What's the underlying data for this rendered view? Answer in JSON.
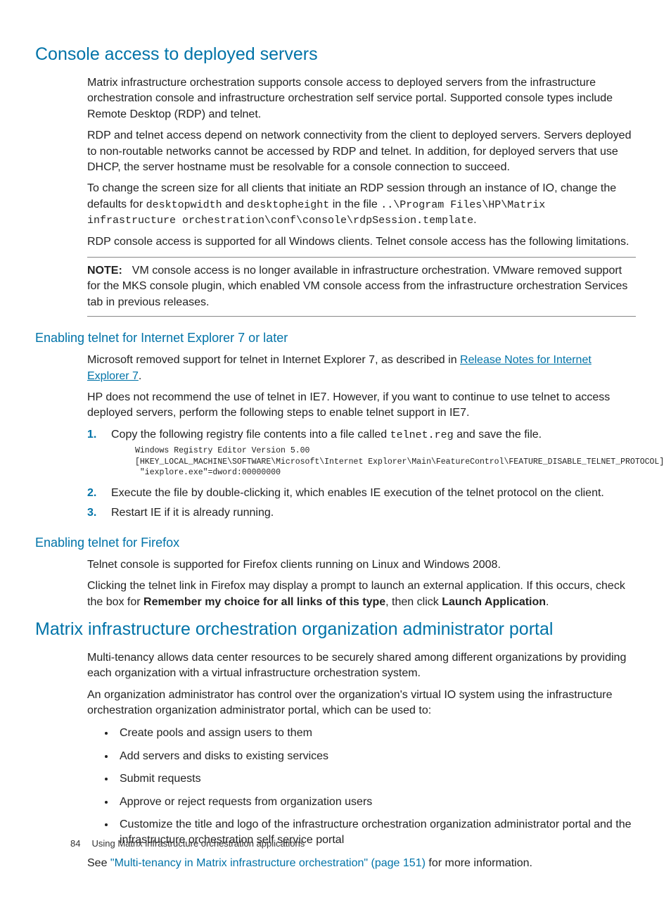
{
  "h1_console": "Console access to deployed servers",
  "console_p1": "Matrix infrastructure orchestration supports console access to deployed servers from the infrastructure orchestration console and infrastructure orchestration self service portal. Supported console types include Remote Desktop (RDP) and telnet.",
  "console_p2": "RDP and telnet access depend on network connectivity from the client to deployed servers. Servers deployed to non-routable networks cannot be accessed by RDP and telnet. In addition, for deployed servers that use DHCP, the server hostname must be resolvable for a console connection to succeed.",
  "console_p3_a": "To change the screen size for all clients that initiate an RDP session through an instance of IO, change the defaults for ",
  "console_p3_code1": "desktopwidth",
  "console_p3_b": " and ",
  "console_p3_code2": "desktopheight",
  "console_p3_c": " in the file ",
  "console_p3_code3": "..\\Program Files\\HP\\Matrix infrastructure orchestration\\conf\\console\\rdpSession.template",
  "console_p3_d": ".",
  "console_p4": "RDP console access is supported for all Windows clients. Telnet console access has the following limitations.",
  "note_label": "NOTE:",
  "note_text": "VM console access is no longer available in infrastructure orchestration. VMware removed support for the MKS console plugin, which enabled VM console access from the infrastructure orchestration Services tab in previous releases.",
  "h_ie7": "Enabling telnet for Internet Explorer 7 or later",
  "ie7_p1_a": "Microsoft removed support for telnet in Internet Explorer 7, as described in ",
  "ie7_link": "Release Notes for Internet Explorer 7",
  "ie7_p1_b": ".",
  "ie7_p2": "HP does not recommend the use of telnet in IE7. However, if you want to continue to use telnet to access deployed servers, perform the following steps to enable telnet support in IE7.",
  "steps": {
    "s1_a": "Copy the following registry file contents into a file called ",
    "s1_code": "telnet.reg",
    "s1_b": " and save the file.",
    "s1_block": "Windows Registry Editor Version 5.00\n[HKEY_LOCAL_MACHINE\\SOFTWARE\\Microsoft\\Internet Explorer\\Main\\FeatureControl\\FEATURE_DISABLE_TELNET_PROTOCOL]\n \"iexplore.exe\"=dword:00000000",
    "s2": "Execute the file by double-clicking it, which enables IE execution of the telnet protocol on the client.",
    "s3": "Restart IE if it is already running."
  },
  "h_ff": "Enabling telnet for Firefox",
  "ff_p1": "Telnet console is supported for Firefox clients running on Linux and Windows 2008.",
  "ff_p2_a": "Clicking the telnet link in Firefox may display a prompt to launch an external application. If this occurs, check the box for ",
  "ff_bold1": "Remember my choice for all links of this type",
  "ff_p2_b": ", then click ",
  "ff_bold2": "Launch Application",
  "ff_p2_c": ".",
  "h1_matrix": "Matrix infrastructure orchestration organization administrator portal",
  "matrix_p1": "Multi-tenancy allows data center resources to be securely shared among different organizations by providing each organization with a virtual infrastructure orchestration system.",
  "matrix_p2": "An organization administrator has control over the organization's virtual IO system using the infrastructure orchestration organization administrator portal, which can be used to:",
  "bullets": [
    "Create pools and assign users to them",
    "Add servers and disks to existing services",
    "Submit requests",
    "Approve or reject requests from organization users",
    "Customize the title and logo of the infrastructure orchestration organization administrator portal and the infrastructure orchestration self service portal"
  ],
  "matrix_see_a": "See ",
  "matrix_see_link": "\"Multi-tenancy in Matrix infrastructure orchestration\" (page 151)",
  "matrix_see_b": " for more information.",
  "footer_page": "84",
  "footer_text": "Using Matrix infrastructure orchestration applications"
}
